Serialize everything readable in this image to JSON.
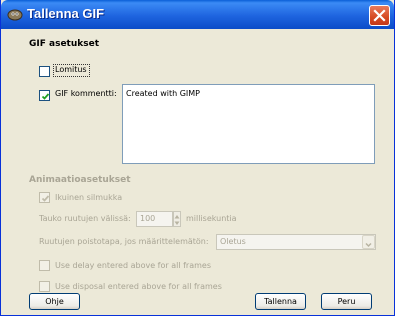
{
  "window": {
    "title": "Tallenna GIF",
    "colors": {
      "titlebar": "#0a5fd7",
      "close": "#d64a22",
      "face": "#ece9d8"
    }
  },
  "gif_section": {
    "heading": "GIF asetukset",
    "interlace": {
      "label": "Lomitus",
      "checked": false
    },
    "comment": {
      "label": "GIF kommentti:",
      "checked": true,
      "value": "Created with GIMP"
    }
  },
  "anim_section": {
    "heading": "Animaatioasetukset",
    "loop": {
      "label": "Ikuinen silmukka",
      "checked": true
    },
    "delay": {
      "label": "Tauko ruutujen välissä:",
      "value": "100",
      "unit": "millisekuntia"
    },
    "disposal": {
      "label": "Ruutujen poistotapa, jos määrittelemätön:",
      "value": "Oletus"
    },
    "use_delay": {
      "label": "Use delay entered above for all frames",
      "checked": false
    },
    "use_disposal": {
      "label": "Use disposal entered above for all frames",
      "checked": false
    }
  },
  "buttons": {
    "help": "Ohje",
    "save": "Tallenna",
    "cancel": "Peru"
  }
}
